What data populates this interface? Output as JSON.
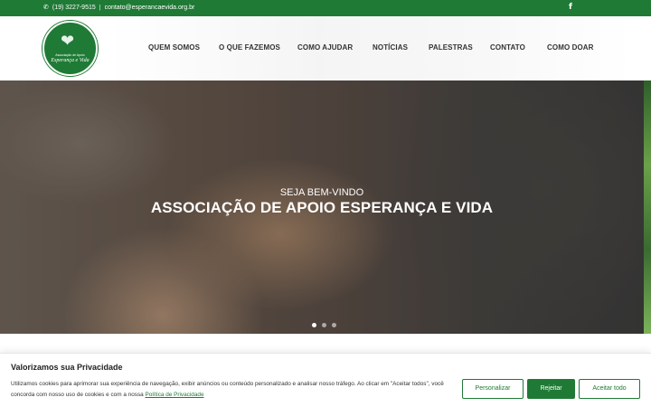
{
  "topbar": {
    "phone": "(19) 3227-9515",
    "separator": "|",
    "email": "contato@esperancaevida.org.br"
  },
  "logo": {
    "line1": "Associação de Apoio",
    "line2": "Esperança e Vida"
  },
  "nav": {
    "items": [
      {
        "label": "QUEM SOMOS"
      },
      {
        "label": "O QUE FAZEMOS"
      },
      {
        "label": "COMO AJUDAR"
      },
      {
        "label": "NOTÍCIAS"
      },
      {
        "label": "PALESTRAS"
      },
      {
        "label": "CONTATO"
      },
      {
        "label": "COMO DOAR"
      }
    ]
  },
  "hero": {
    "subtitle": "SEJA BEM-VINDO",
    "title": "ASSOCIAÇÃO DE APOIO ESPERANÇA E VIDA",
    "slide_count": 3,
    "active_slide": 1
  },
  "cookie": {
    "title": "Valorizamos sua Privacidade",
    "text": "Utilizamos cookies para aprimorar sua experiência de navegação, exibir anúncios ou conteúdo personalizado e analisar nosso tráfego. Ao clicar em \"Aceitar todos\", você concorda com nosso uso de cookies e com a nossa",
    "policy_link": "Política de Privacidade",
    "customize_label": "Personalizar",
    "reject_label": "Rejeitar",
    "accept_label": "Aceitar todo"
  },
  "icons": {
    "phone": "phone-icon",
    "social": "facebook-icon"
  },
  "colors": {
    "brand_green": "#1f7a35"
  }
}
